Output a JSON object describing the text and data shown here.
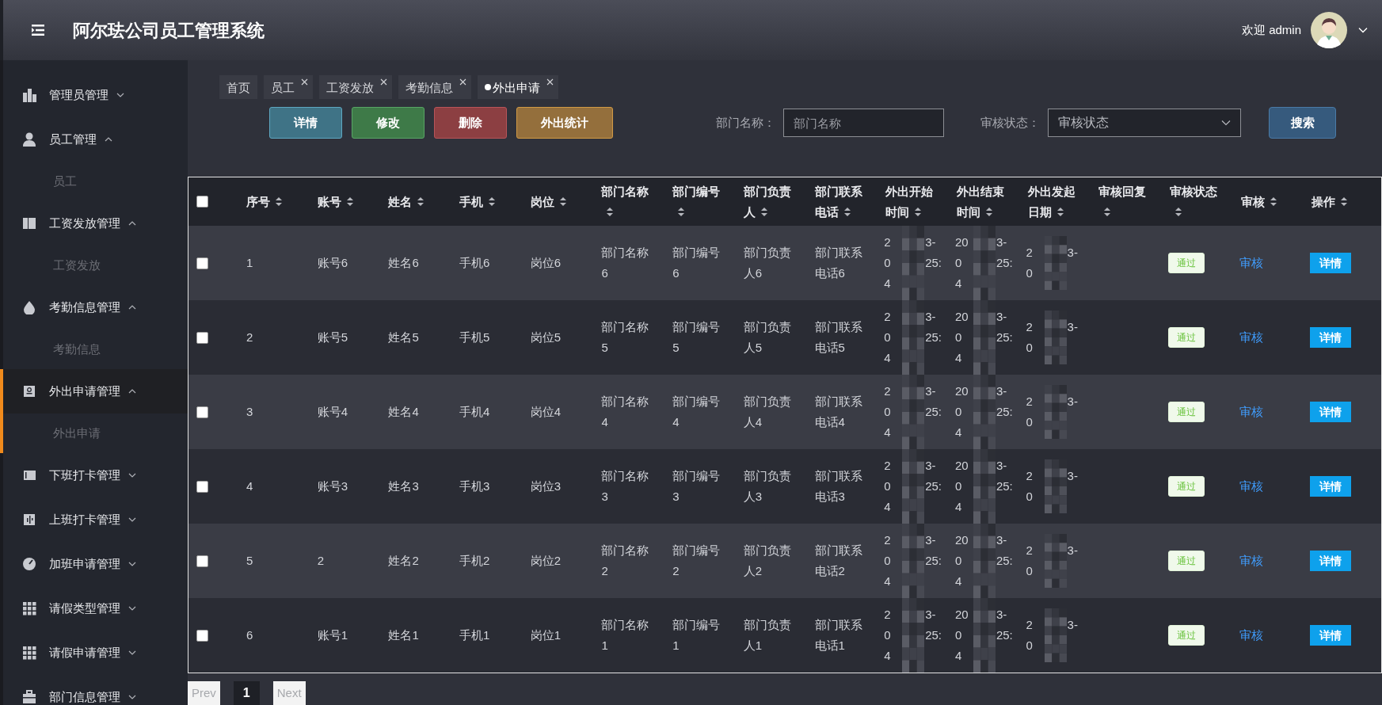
{
  "header": {
    "title": "阿尔珐公司员工管理系统",
    "welcome": "欢迎 admin"
  },
  "sidebar": {
    "items": [
      {
        "label": "管理员管理",
        "expanded": false,
        "selected": false
      },
      {
        "label": "员工管理",
        "expanded": true,
        "selected": false,
        "children": [
          {
            "label": "员工"
          }
        ]
      },
      {
        "label": "工资发放管理",
        "expanded": true,
        "selected": false,
        "children": [
          {
            "label": "工资发放"
          }
        ]
      },
      {
        "label": "考勤信息管理",
        "expanded": true,
        "selected": false,
        "children": [
          {
            "label": "考勤信息"
          }
        ]
      },
      {
        "label": "外出申请管理",
        "expanded": true,
        "selected": true,
        "children": [
          {
            "label": "外出申请"
          }
        ]
      },
      {
        "label": "下班打卡管理",
        "expanded": false,
        "selected": false
      },
      {
        "label": "上班打卡管理",
        "expanded": false,
        "selected": false
      },
      {
        "label": "加班申请管理",
        "expanded": false,
        "selected": false
      },
      {
        "label": "请假类型管理",
        "expanded": false,
        "selected": false
      },
      {
        "label": "请假申请管理",
        "expanded": false,
        "selected": false
      },
      {
        "label": "部门信息管理",
        "expanded": false,
        "selected": false
      }
    ]
  },
  "tabs": [
    {
      "label": "首页",
      "closable": false,
      "selected": false
    },
    {
      "label": "员工",
      "closable": true,
      "selected": false
    },
    {
      "label": "工资发放",
      "closable": true,
      "selected": false
    },
    {
      "label": "考勤信息",
      "closable": true,
      "selected": false
    },
    {
      "label": "外出申请",
      "closable": true,
      "selected": true
    }
  ],
  "toolbar": [
    {
      "label": "详情",
      "color": "#3f7386"
    },
    {
      "label": "修改",
      "color": "#3e7a48"
    },
    {
      "label": "删除",
      "color": "#8c3f42"
    },
    {
      "label": "外出统计",
      "color": "#946f3c"
    }
  ],
  "filters": [
    {
      "label": "部门名称：",
      "placeholder": "部门名称",
      "kind": "input"
    },
    {
      "label": "审核状态：",
      "placeholder": "审核状态",
      "kind": "select"
    }
  ],
  "search_button": "搜索",
  "table": {
    "select_all_checked": false,
    "columns": [
      "序号",
      "账号",
      "姓名",
      "手机",
      "岗位",
      "部门名称",
      "部门编号",
      "部门负责人",
      "部门联系电话",
      "外出开始时间",
      "外出结束时间",
      "外出发起日期",
      "审核回复",
      "审核状态",
      "审核",
      "操作"
    ],
    "rows": [
      {
        "checked": false,
        "cells": [
          "1",
          "账号6",
          "姓名6",
          "手机6",
          "岗位6",
          "部门名称6",
          "部门编号6",
          "部门负责人6",
          "部门联系电话6"
        ],
        "start_time": [
          [
            "2",
            "3-"
          ],
          [
            "0",
            "25:"
          ],
          [
            "4"
          ]
        ],
        "end_time": [
          [
            "20",
            "3-"
          ],
          [
            "0",
            "25:"
          ],
          [
            "4"
          ]
        ],
        "issue_date": [
          [
            "2",
            "3-"
          ],
          [
            "0"
          ]
        ],
        "status": "通过",
        "review": "审核",
        "action": "详情"
      },
      {
        "checked": false,
        "cells": [
          "2",
          "账号5",
          "姓名5",
          "手机5",
          "岗位5",
          "部门名称5",
          "部门编号5",
          "部门负责人5",
          "部门联系电话5"
        ],
        "start_time": [
          [
            "2",
            "3-"
          ],
          [
            "0",
            "25:"
          ],
          [
            "4"
          ]
        ],
        "end_time": [
          [
            "20",
            "3-"
          ],
          [
            "0",
            "25:"
          ],
          [
            "4"
          ]
        ],
        "issue_date": [
          [
            "2",
            "3-"
          ],
          [
            "0"
          ]
        ],
        "status": "通过",
        "review": "审核",
        "action": "详情"
      },
      {
        "checked": false,
        "cells": [
          "3",
          "账号4",
          "姓名4",
          "手机4",
          "岗位4",
          "部门名称4",
          "部门编号4",
          "部门负责人4",
          "部门联系电话4"
        ],
        "start_time": [
          [
            "2",
            "3-"
          ],
          [
            "0",
            "25:"
          ],
          [
            "4"
          ]
        ],
        "end_time": [
          [
            "20",
            "3-"
          ],
          [
            "0",
            "25:"
          ],
          [
            "4"
          ]
        ],
        "issue_date": [
          [
            "2",
            "3-"
          ],
          [
            "0"
          ]
        ],
        "status": "通过",
        "review": "审核",
        "action": "详情"
      },
      {
        "checked": false,
        "cells": [
          "4",
          "账号3",
          "姓名3",
          "手机3",
          "岗位3",
          "部门名称3",
          "部门编号3",
          "部门负责人3",
          "部门联系电话3"
        ],
        "start_time": [
          [
            "2",
            "3-"
          ],
          [
            "0",
            "25:"
          ],
          [
            "4"
          ]
        ],
        "end_time": [
          [
            "20",
            "3-"
          ],
          [
            "0",
            "25:"
          ],
          [
            "4"
          ]
        ],
        "issue_date": [
          [
            "2",
            "3-"
          ],
          [
            "0"
          ]
        ],
        "status": "通过",
        "review": "审核",
        "action": "详情"
      },
      {
        "checked": false,
        "cells": [
          "5",
          "2",
          "姓名2",
          "手机2",
          "岗位2",
          "部门名称2",
          "部门编号2",
          "部门负责人2",
          "部门联系电话2"
        ],
        "start_time": [
          [
            "2",
            "3-"
          ],
          [
            "0",
            "25:"
          ],
          [
            "4"
          ]
        ],
        "end_time": [
          [
            "20",
            "3-"
          ],
          [
            "0",
            "25:"
          ],
          [
            "4"
          ]
        ],
        "issue_date": [
          [
            "2",
            "3-"
          ],
          [
            "0"
          ]
        ],
        "status": "通过",
        "review": "审核",
        "action": "详情"
      },
      {
        "checked": false,
        "cells": [
          "6",
          "账号1",
          "姓名1",
          "手机1",
          "岗位1",
          "部门名称1",
          "部门编号1",
          "部门负责人1",
          "部门联系电话1"
        ],
        "start_time": [
          [
            "2",
            "3-"
          ],
          [
            "0",
            "25:"
          ],
          [
            "4"
          ]
        ],
        "end_time": [
          [
            "20",
            "3-"
          ],
          [
            "0",
            "25:"
          ],
          [
            "4"
          ]
        ],
        "issue_date": [
          [
            "2",
            "3-"
          ],
          [
            "0"
          ]
        ],
        "status": "通过",
        "review": "审核",
        "action": "详情"
      }
    ]
  },
  "pagination": [
    {
      "label": "Prev",
      "kind": "nav"
    },
    {
      "label": "1",
      "kind": "page",
      "selected": true
    },
    {
      "label": "Next",
      "kind": "nav"
    }
  ]
}
